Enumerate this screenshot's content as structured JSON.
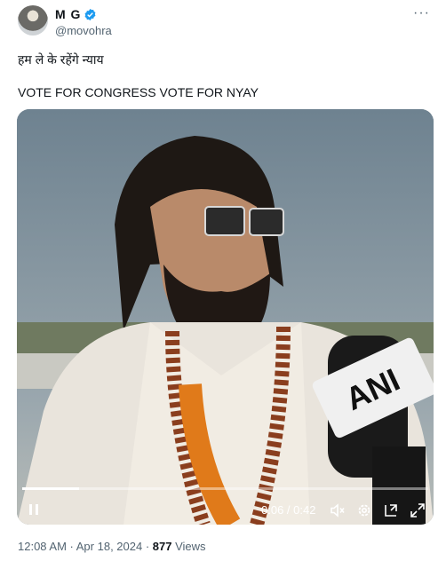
{
  "tweet": {
    "display_name": "M G",
    "handle": "@movohra",
    "text_line1": "हम ले के रहेंगे न्याय",
    "text_line2": "VOTE FOR CONGRESS VOTE FOR NYAY",
    "timestamp": "12:08 AM · Apr 18, 2024 · ",
    "views_count": "877",
    "views_label": " Views"
  },
  "video": {
    "current_time": "0:06",
    "time_separator": " / ",
    "duration": "0:42",
    "progress_fraction": 0.14,
    "mic_label": "ANI"
  },
  "icons": {
    "verified": "verified-badge-icon",
    "more": "more-options-icon",
    "pause": "pause-icon",
    "mute": "mute-icon",
    "settings": "settings-gear-icon",
    "pip": "picture-in-picture-icon",
    "fullscreen": "fullscreen-icon"
  },
  "colors": {
    "verified": "#1d9bf0",
    "secondary_text": "#536471"
  }
}
